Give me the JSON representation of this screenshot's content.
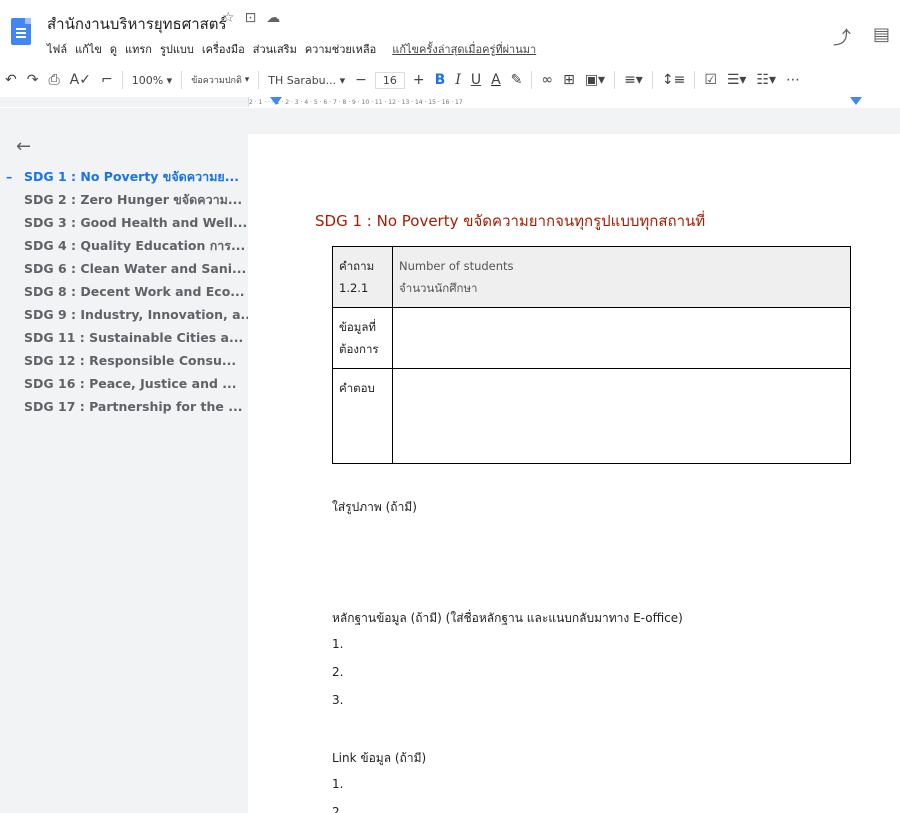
{
  "header": {
    "doc_title": "สำนักงานบริหารยุทธศาสตร์",
    "menu": [
      "ไฟล์",
      "แก้ไข",
      "ดู",
      "แทรก",
      "รูปแบบ",
      "เครื่องมือ",
      "ส่วนเสริม",
      "ความช่วยเหลือ"
    ],
    "last_edit": "แก้ไขครั้งล่าสุดเมื่อครู่ที่ผ่านมา"
  },
  "toolbar": {
    "zoom": "100%",
    "style": "ข้อความปกติ",
    "font": "TH Sarabu...",
    "font_size": "16",
    "bold": "B",
    "italic": "I",
    "underline": "U",
    "text_color": "A"
  },
  "ruler": {
    "ticks": "2 · 1 · · · 1 · 2 · 3 · 4 · 5 · 6 · 7 · 8 · 9 · 10 · 11 · 12 · 13 · 14 · 15 · 16 · 17"
  },
  "outline": {
    "items": [
      "SDG 1 : No Poverty ขจัดความย...",
      "SDG 2 : Zero Hunger ขจัดความ...",
      "SDG 3 : Good Health and Well...",
      "SDG 4 : Quality Education การ...",
      "SDG 6 : Clean Water and Sani...",
      "SDG 8 : Decent Work and Eco...",
      "SDG 9 : Industry, Innovation, a...",
      "SDG 11 : Sustainable Cities a...",
      "SDG 12 : Responsible Consu...",
      "SDG 16 : Peace, Justice and ...",
      "SDG 17 : Partnership for the ..."
    ]
  },
  "document": {
    "heading": "SDG 1 :  No Poverty ขจัดความยากจนทุกรูปแบบทุกสถานที่",
    "table": {
      "q_label_1": "คำถาม",
      "q_label_2": "1.2.1",
      "q_text_1": "Number of students",
      "q_text_2": "จำนวนนักศึกษา",
      "data_label_1": "ข้อมูลที่",
      "data_label_2": "ต้องการ",
      "answer_label": "คำตอบ"
    },
    "image_note": "ใส่รูปภาพ (ถ้ามี)",
    "evidence_title": "หลักฐานข้อมูล (ถ้ามี) (ใส่ชื่อหลักฐาน และแนบกลับมาทาง E-office)",
    "evidence_items": [
      "1.",
      "2.",
      "3."
    ],
    "link_title": "Link ข้อมูล (ถ้ามี)",
    "link_items": [
      "1.",
      "2."
    ]
  }
}
